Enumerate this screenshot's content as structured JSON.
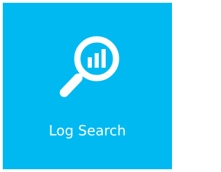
{
  "tile": {
    "label": "Log Search",
    "icon": "magnifier-bar-chart-icon",
    "colors": {
      "background": "#00b9f1",
      "foreground": "#ffffff",
      "page": "#ffffff"
    }
  }
}
